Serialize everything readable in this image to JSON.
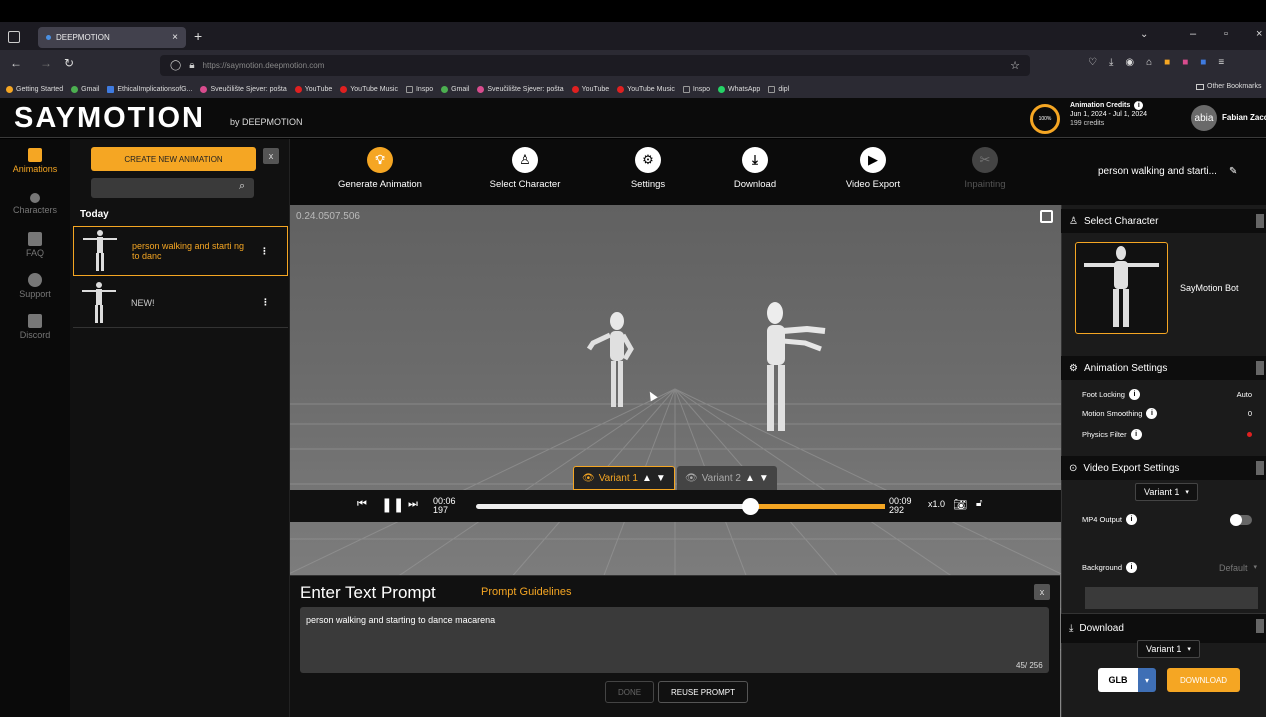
{
  "browser": {
    "tab_title": "DEEPMOTION",
    "url": "https://saymotion.deepmotion.com",
    "bookmarks": [
      {
        "label": "Getting Started",
        "color": "#f5a623"
      },
      {
        "label": "Gmail",
        "color": "#4caf50"
      },
      {
        "label": "EthicalImplicationsofG...",
        "color": "#3f7be0"
      },
      {
        "label": "Sveučilište Sjever: pošta",
        "color": "#d94c8e"
      },
      {
        "label": "YouTube",
        "color": "#e02020"
      },
      {
        "label": "YouTube Music",
        "color": "#e02020"
      },
      {
        "label": "Inspo",
        "color": "#999999"
      },
      {
        "label": "Gmail",
        "color": "#4caf50"
      },
      {
        "label": "Sveučilište Sjever: pošta",
        "color": "#d94c8e"
      },
      {
        "label": "YouTube",
        "color": "#e02020"
      },
      {
        "label": "YouTube Music",
        "color": "#e02020"
      },
      {
        "label": "Inspo",
        "color": "#999999"
      },
      {
        "label": "WhatsApp",
        "color": "#25d366"
      },
      {
        "label": "dipl",
        "color": "#999999"
      }
    ],
    "other_bookmarks": "Other Bookmarks"
  },
  "header": {
    "logo": "SAYMOTION",
    "logo_sub": "by DEEPMOTION",
    "credits_title": "Animation Credits",
    "credits_dates": "Jun 1, 2024 - Jul 1, 2024",
    "credits_count": "199 credits",
    "credits_percent": "100%",
    "avatar_initials": "abia",
    "user_name": "Fabian Zaccar"
  },
  "sidebar": [
    {
      "label": "Animations",
      "active": true
    },
    {
      "label": "Characters",
      "active": false
    },
    {
      "label": "FAQ",
      "active": false
    },
    {
      "label": "Support",
      "active": false
    },
    {
      "label": "Discord",
      "active": false
    }
  ],
  "list": {
    "create_label": "CREATE NEW ANIMATION",
    "close_label": "x",
    "section": "Today",
    "items": [
      {
        "title": "person walking and starti ng to danc"
      },
      {
        "title": "NEW!"
      }
    ]
  },
  "toolbar": {
    "items": [
      {
        "label": "Generate Animation",
        "icon": "lightbulb-icon"
      },
      {
        "label": "Select Character",
        "icon": "character-icon"
      },
      {
        "label": "Settings",
        "icon": "gear-icon"
      },
      {
        "label": "Download",
        "icon": "download-icon"
      },
      {
        "label": "Video Export",
        "icon": "play-icon"
      },
      {
        "label": "Inpainting",
        "icon": "inpainting-icon"
      }
    ],
    "animation_name": "person walking and starti..."
  },
  "viewport": {
    "version": "0.24.0507.506"
  },
  "variants": [
    {
      "label": "Variant 1"
    },
    {
      "label": "Variant 2"
    }
  ],
  "player": {
    "current_time": "00:06",
    "current_frame": "197",
    "total_time": "00:09",
    "total_frame": "292",
    "speed": "x1.0",
    "progress": 0.67
  },
  "prompt": {
    "title": "Enter Text Prompt",
    "guidelines": "Prompt Guidelines",
    "text": "person walking and starting to dance macarena",
    "count": "45/ 256",
    "done_label": "DONE",
    "reuse_label": "REUSE PROMPT"
  },
  "right": {
    "select_character": {
      "title": "Select Character",
      "character_name": "SayMotion Bot"
    },
    "animation_settings": {
      "title": "Animation Settings",
      "rows": [
        {
          "label": "Foot Locking",
          "value": "Auto"
        },
        {
          "label": "Motion Smoothing",
          "value": "0"
        },
        {
          "label": "Physics Filter",
          "value": ""
        }
      ]
    },
    "video_export": {
      "title": "Video Export Settings",
      "variant": "Variant 1",
      "mp4_label": "MP4 Output",
      "background_label": "Background",
      "background_value": "Default"
    },
    "download": {
      "title": "Download",
      "variant": "Variant 1",
      "format": "GLB",
      "button": "DOWNLOAD"
    }
  },
  "colors": {
    "accent": "#f5a623",
    "panel": "#1b1b1b"
  }
}
